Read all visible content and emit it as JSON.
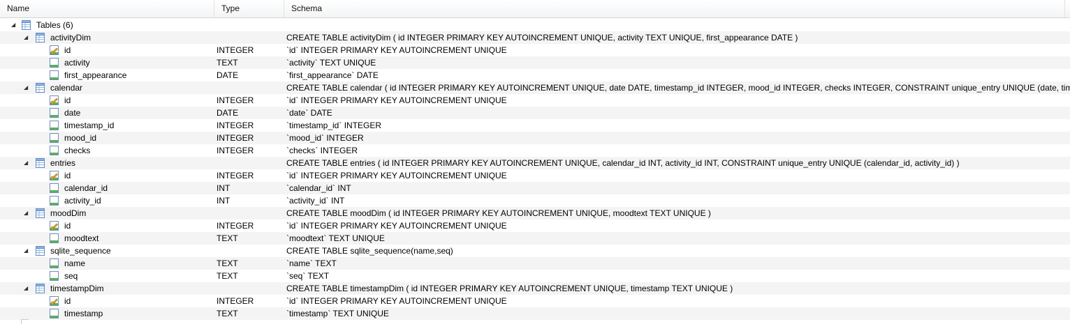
{
  "header": {
    "name": "Name",
    "type": "Type",
    "schema": "Schema"
  },
  "tree": {
    "root_label": "Tables (6)",
    "tables": [
      {
        "name": "activityDim",
        "schema": "CREATE TABLE activityDim ( id INTEGER PRIMARY KEY AUTOINCREMENT UNIQUE, activity TEXT UNIQUE, first_appearance DATE )",
        "fields": [
          {
            "name": "id",
            "type": "INTEGER",
            "schema": "`id` INTEGER PRIMARY KEY AUTOINCREMENT UNIQUE",
            "key": true
          },
          {
            "name": "activity",
            "type": "TEXT",
            "schema": "`activity` TEXT UNIQUE",
            "key": false
          },
          {
            "name": "first_appearance",
            "type": "DATE",
            "schema": "`first_appearance` DATE",
            "key": false
          }
        ]
      },
      {
        "name": "calendar",
        "schema": "CREATE TABLE calendar ( id INTEGER PRIMARY KEY AUTOINCREMENT UNIQUE, date DATE, timestamp_id INTEGER, mood_id INTEGER, checks INTEGER, CONSTRAINT unique_entry UNIQUE (date, timestamp_id) )",
        "fields": [
          {
            "name": "id",
            "type": "INTEGER",
            "schema": "`id` INTEGER PRIMARY KEY AUTOINCREMENT UNIQUE",
            "key": true
          },
          {
            "name": "date",
            "type": "DATE",
            "schema": "`date` DATE",
            "key": false
          },
          {
            "name": "timestamp_id",
            "type": "INTEGER",
            "schema": "`timestamp_id` INTEGER",
            "key": false
          },
          {
            "name": "mood_id",
            "type": "INTEGER",
            "schema": "`mood_id` INTEGER",
            "key": false
          },
          {
            "name": "checks",
            "type": "INTEGER",
            "schema": "`checks` INTEGER",
            "key": false
          }
        ]
      },
      {
        "name": "entries",
        "schema": "CREATE TABLE entries ( id INTEGER PRIMARY KEY AUTOINCREMENT UNIQUE, calendar_id INT, activity_id INT, CONSTRAINT unique_entry UNIQUE (calendar_id, activity_id) )",
        "fields": [
          {
            "name": "id",
            "type": "INTEGER",
            "schema": "`id` INTEGER PRIMARY KEY AUTOINCREMENT UNIQUE",
            "key": true
          },
          {
            "name": "calendar_id",
            "type": "INT",
            "schema": "`calendar_id` INT",
            "key": false
          },
          {
            "name": "activity_id",
            "type": "INT",
            "schema": "`activity_id` INT",
            "key": false
          }
        ]
      },
      {
        "name": "moodDim",
        "schema": "CREATE TABLE moodDim ( id INTEGER PRIMARY KEY AUTOINCREMENT UNIQUE, moodtext TEXT UNIQUE )",
        "fields": [
          {
            "name": "id",
            "type": "INTEGER",
            "schema": "`id` INTEGER PRIMARY KEY AUTOINCREMENT UNIQUE",
            "key": true
          },
          {
            "name": "moodtext",
            "type": "TEXT",
            "schema": "`moodtext` TEXT UNIQUE",
            "key": false
          }
        ]
      },
      {
        "name": "sqlite_sequence",
        "schema": "CREATE TABLE sqlite_sequence(name,seq)",
        "fields": [
          {
            "name": "name",
            "type": "TEXT",
            "schema": "`name` TEXT",
            "key": false
          },
          {
            "name": "seq",
            "type": "TEXT",
            "schema": "`seq` TEXT",
            "key": false
          }
        ]
      },
      {
        "name": "timestampDim",
        "schema": "CREATE TABLE timestampDim ( id INTEGER PRIMARY KEY AUTOINCREMENT UNIQUE, timestamp TEXT UNIQUE )",
        "fields": [
          {
            "name": "id",
            "type": "INTEGER",
            "schema": "`id` INTEGER PRIMARY KEY AUTOINCREMENT UNIQUE",
            "key": true
          },
          {
            "name": "timestamp",
            "type": "TEXT",
            "schema": "`timestamp` TEXT UNIQUE",
            "key": false
          }
        ]
      }
    ]
  },
  "icons": {
    "expand": "expanded-arrow-icon",
    "table": "table-icon",
    "field": "field-icon",
    "key_field": "primary-key-field-icon"
  },
  "colors": {
    "row_alt": "#f4f4f4",
    "icon_blue": "#5b8cc9",
    "key_gold": "#e2a92a"
  }
}
